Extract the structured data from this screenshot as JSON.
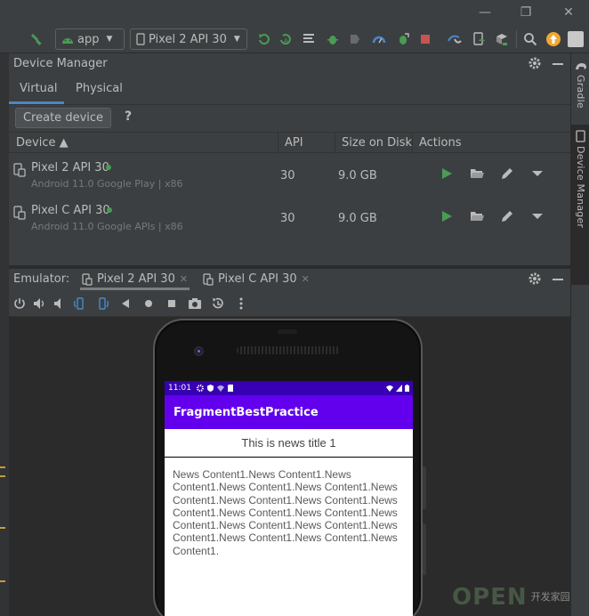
{
  "toolbar": {
    "run_config": "app",
    "device_selector": "Pixel 2 API 30"
  },
  "side_tabs": {
    "gradle": "Gradle",
    "device_manager": "Device Manager"
  },
  "device_manager": {
    "title": "Device Manager",
    "tabs": [
      "Virtual",
      "Physical"
    ],
    "create_button": "Create device",
    "help": "?",
    "columns": {
      "device": "Device ▲",
      "api": "API",
      "size": "Size on Disk",
      "actions": "Actions"
    },
    "devices": [
      {
        "name": "Pixel 2 API 30",
        "subtitle": "Android 11.0 Google Play | x86",
        "api": "30",
        "size": "9.0 GB"
      },
      {
        "name": "Pixel C API 30",
        "subtitle": "Android 11.0 Google APIs | x86",
        "api": "30",
        "size": "9.0 GB"
      }
    ]
  },
  "emulator": {
    "label": "Emulator:",
    "tabs": [
      "Pixel 2 API 30",
      "Pixel C API 30"
    ]
  },
  "phone": {
    "time": "11:01",
    "app_title": "FragmentBestPractice",
    "news_title": "This is news title 1",
    "news_content": "News Content1.News Content1.News Content1.News Content1.News Content1.News Content1.News Content1.News Content1.News Content1.News Content1.News Content1.News Content1.News Content1.News Content1.News Content1.News Content1.News Content1.News Content1."
  },
  "watermark": {
    "logo": "OPEN",
    "cn": "开发家园"
  },
  "colors": {
    "ide_bg": "#3c3f41",
    "selection_blue": "#4a88c7",
    "run_green": "#499c54",
    "status_bar": "#3700b3",
    "app_bar": "#6200ee"
  }
}
